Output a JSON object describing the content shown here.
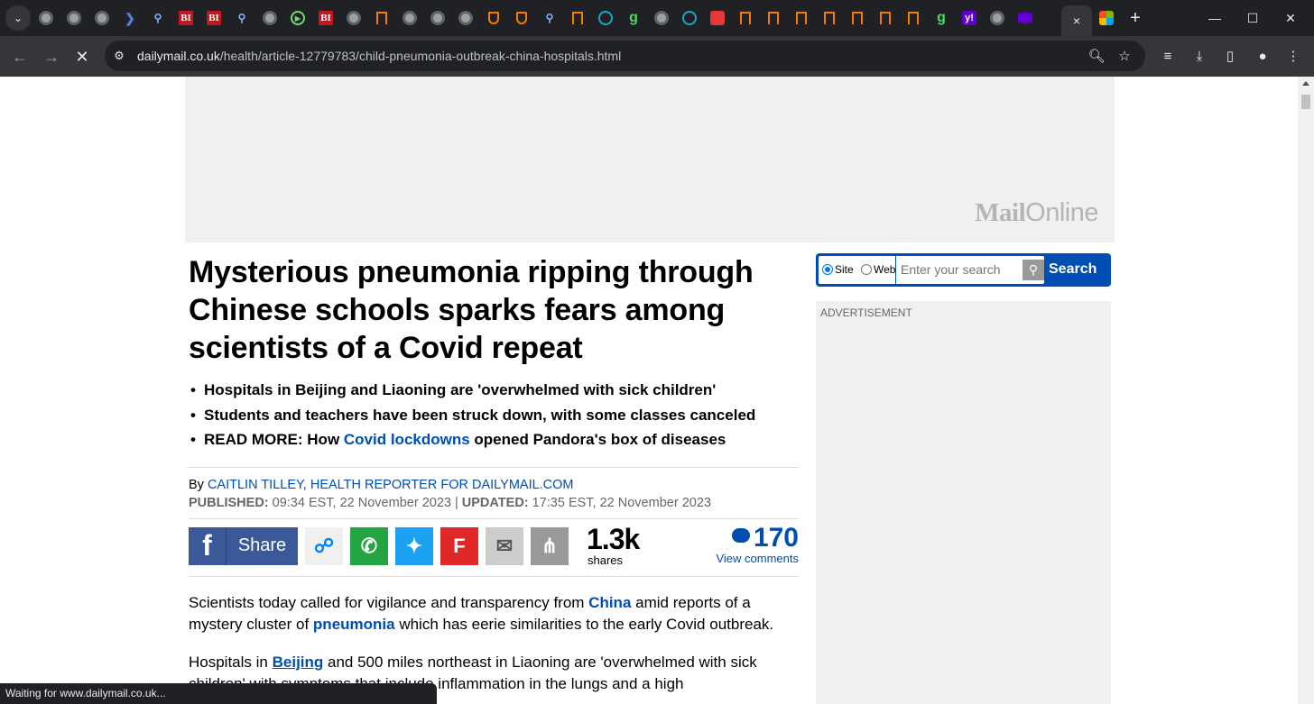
{
  "browser": {
    "active_tab_close": "×",
    "new_tab": "+",
    "address": {
      "host": "dailymail.co.uk",
      "path": "/health/article-12779783/child-pneumonia-outbreak-china-hospitals.html"
    },
    "status_text": "Waiting for www.dailymail.co.uk...",
    "tabs": [
      {
        "icon": "globe-icon"
      },
      {
        "icon": "globe-icon"
      },
      {
        "icon": "globe-icon"
      },
      {
        "icon": "arrow-icon"
      },
      {
        "icon": "search-icon"
      },
      {
        "icon": "bi-icon",
        "text": "BI"
      },
      {
        "icon": "bi-icon",
        "text": "BI"
      },
      {
        "icon": "search-icon"
      },
      {
        "icon": "globe-icon"
      },
      {
        "icon": "play-icon"
      },
      {
        "icon": "bi-icon",
        "text": "BI"
      },
      {
        "icon": "globe-icon"
      },
      {
        "icon": "bookmark-icon"
      },
      {
        "icon": "globe-icon"
      },
      {
        "icon": "globe-icon"
      },
      {
        "icon": "globe-icon"
      },
      {
        "icon": "shield-icon"
      },
      {
        "icon": "shield-icon"
      },
      {
        "icon": "search-icon"
      },
      {
        "icon": "bookmark-icon"
      },
      {
        "icon": "dark-shield-icon"
      },
      {
        "icon": "g-icon",
        "text": "g"
      },
      {
        "icon": "globe-icon"
      },
      {
        "icon": "dark-shield-icon"
      },
      {
        "icon": "red-icon"
      },
      {
        "icon": "bookmark-icon"
      },
      {
        "icon": "bookmark-icon"
      },
      {
        "icon": "bookmark-icon"
      },
      {
        "icon": "bookmark-icon"
      },
      {
        "icon": "bookmark-icon"
      },
      {
        "icon": "bookmark-icon"
      },
      {
        "icon": "bookmark-icon"
      },
      {
        "icon": "g-icon",
        "text": "g"
      },
      {
        "icon": "yahoo-icon",
        "text": "y!"
      },
      {
        "icon": "globe-icon"
      },
      {
        "icon": "yahoo-mail-icon"
      }
    ]
  },
  "banner": {
    "logo_bold": "Mail",
    "logo_light": "Online"
  },
  "article": {
    "headline": "Mysterious pneumonia ripping through Chinese schools sparks fears among scientists of a Covid repeat",
    "bullets": {
      "b1": "Hospitals in Beijing and Liaoning are 'overwhelmed with sick children'",
      "b2": "Students and teachers have been struck down, with some classes canceled",
      "b3_pre": "READ MORE: How ",
      "b3_link": "Covid lockdowns",
      "b3_post": " opened Pandora's box of diseases"
    },
    "byline": {
      "by": "By ",
      "author": "CAITLIN TILLEY, HEALTH REPORTER FOR DAILYMAIL.COM",
      "published_label": "PUBLISHED:",
      "published": " 09:34 EST, 22 November 2023 | ",
      "updated_label": "UPDATED:",
      "updated": " 17:35 EST, 22 November 2023"
    },
    "share": {
      "fb_label": "Share",
      "count": "1.3k",
      "count_label": "shares",
      "comments_count": "170",
      "comments_label": "View comments"
    },
    "para1": {
      "t1": "Scientists today called for vigilance and transparency from ",
      "l1": "China",
      "t2": " amid reports of a mystery cluster of ",
      "l2": "pneumonia",
      "t3": " which has eerie similarities to the early Covid outbreak."
    },
    "para2": {
      "t1": "Hospitals in ",
      "l1": "Beijing",
      "t2": " and 500 miles northeast in Liaoning are 'overwhelmed with sick children' with symptoms that include inflammation in the lungs and a high"
    }
  },
  "sidebar": {
    "search": {
      "opt_site": "Site",
      "opt_web": "Web",
      "selected": "Site",
      "placeholder": "Enter your search",
      "button": "Search"
    },
    "ad_label": "ADVERTISEMENT"
  },
  "colors": {
    "link": "#004db3",
    "facebook": "#3b5998",
    "whatsapp": "#25a443",
    "twitter": "#1da1f2",
    "flipboard": "#e12828"
  }
}
